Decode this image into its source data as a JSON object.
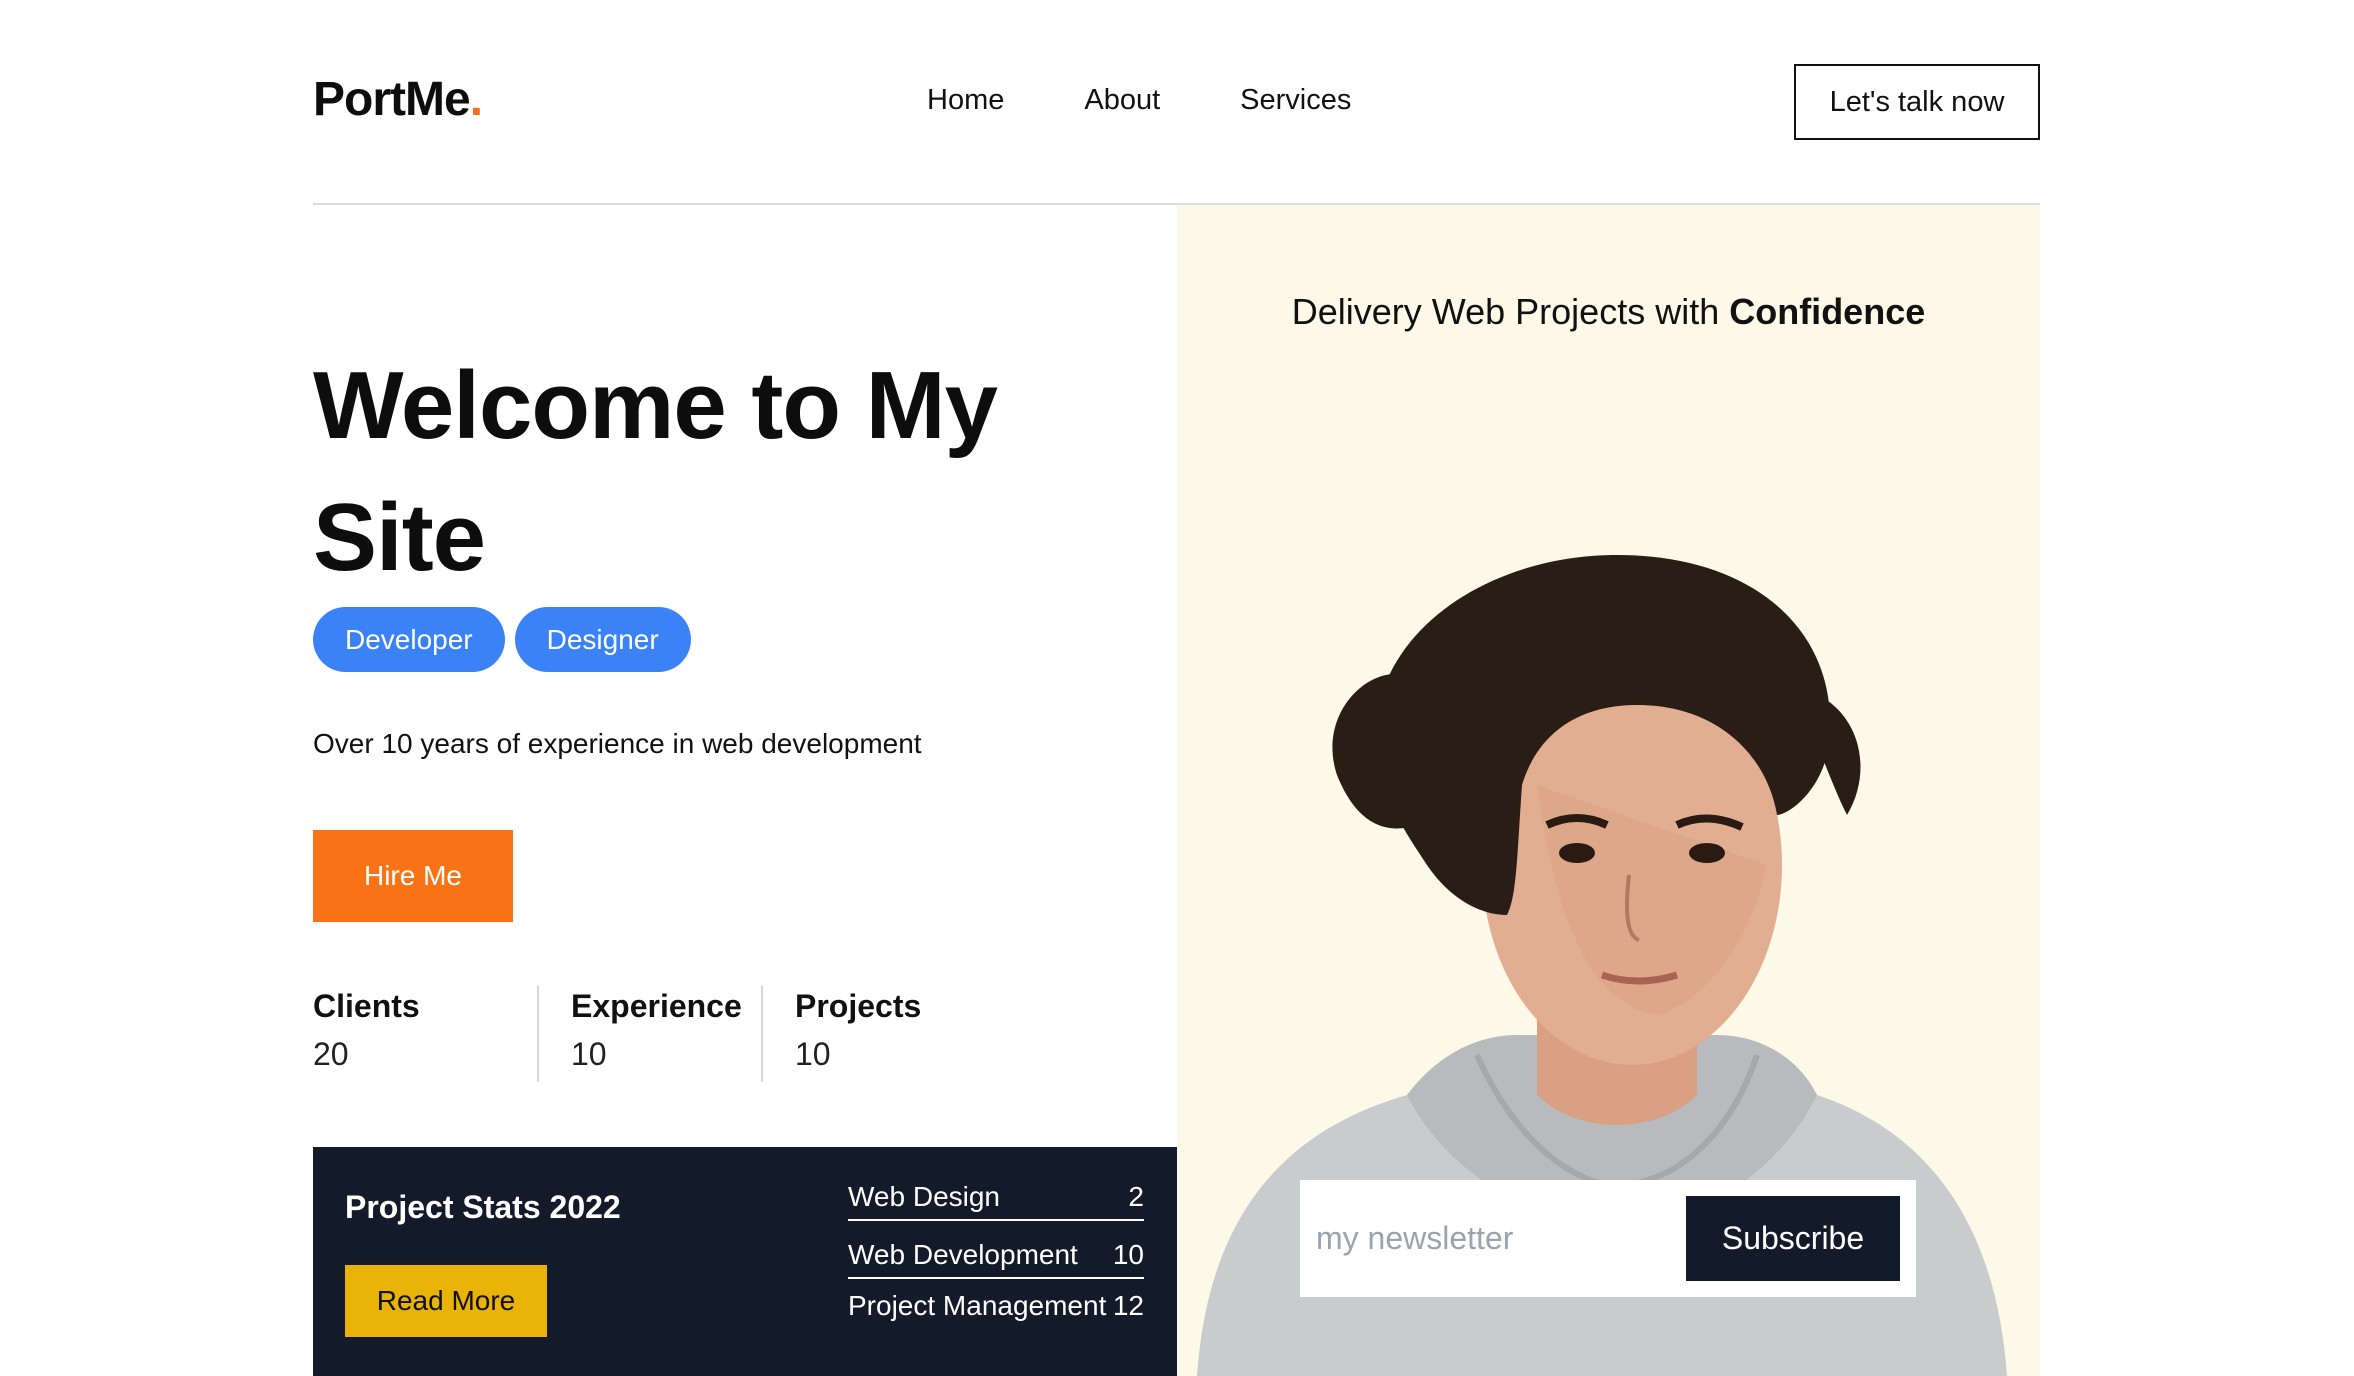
{
  "header": {
    "logo_text": "PortMe",
    "logo_dot": ".",
    "nav": [
      "Home",
      "About",
      "Services"
    ],
    "cta_label": "Let's talk now"
  },
  "hero": {
    "title": "Welcome to My Site",
    "tags": [
      "Developer",
      "Designer"
    ],
    "intro": "Over 10 years of experience in web development",
    "hire_label": "Hire Me",
    "stats": [
      {
        "label": "Clients",
        "value": "20"
      },
      {
        "label": "Experience",
        "value": "10"
      },
      {
        "label": "Projects",
        "value": "10"
      }
    ]
  },
  "project_stats": {
    "title": "Project Stats 2022",
    "read_more_label": "Read More",
    "items": [
      {
        "name": "Web Design",
        "count": "2"
      },
      {
        "name": "Web Development",
        "count": "10"
      },
      {
        "name": "Project Management",
        "count": "12"
      }
    ]
  },
  "showcase": {
    "tagline_prefix": "Delivery Web Projects with ",
    "tagline_bold": "Confidence",
    "newsletter_placeholder": "my newsletter",
    "subscribe_label": "Subscribe"
  },
  "colors": {
    "accent_orange": "#f97316",
    "tag_blue": "#3b82f6",
    "panel_navy": "#131a2a",
    "read_more_yellow": "#eab308",
    "showcase_bg": "#fcf9e9"
  }
}
